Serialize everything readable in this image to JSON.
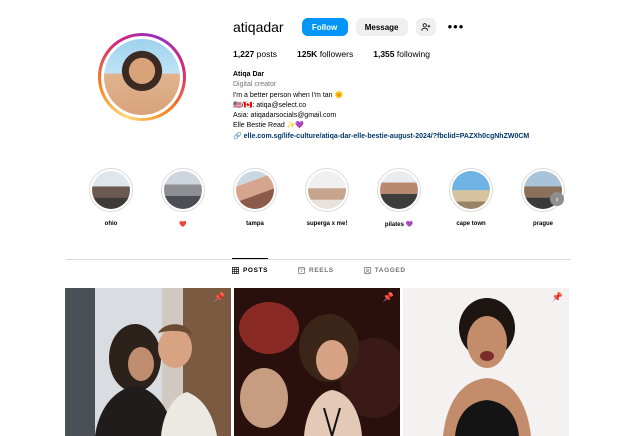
{
  "profile": {
    "username": "atiqadar",
    "follow_label": "Follow",
    "message_label": "Message",
    "more_label": "•••",
    "stats": {
      "posts_count": "1,227",
      "posts_label": "posts",
      "followers_count": "125K",
      "followers_label": "followers",
      "following_count": "1,355",
      "following_label": "following"
    },
    "bio": {
      "name": "Atiqa Dar",
      "category": "Digital creator",
      "line1": "I'm a better person when I'm tan 🌞",
      "line2": "🇺🇸/🇨🇦: atiqa@select.co",
      "line3": "Asia: atiqadarsocials@gmail.com",
      "line4": "Elle Bestie Read ✨💜",
      "link": "🔗 elle.com.sg/life-culture/atiqa-dar-elle-bestie-august-2024/?fbclid=PAZXh0cgNhZW0CM"
    }
  },
  "highlights": [
    {
      "label": "ohio"
    },
    {
      "label": "❤️"
    },
    {
      "label": "tampa"
    },
    {
      "label": "superga x me!"
    },
    {
      "label": "pilates 💜"
    },
    {
      "label": "cape town"
    },
    {
      "label": "prague"
    }
  ],
  "tabs": {
    "posts": "POSTS",
    "reels": "REELS",
    "tagged": "TAGGED"
  },
  "colors": {
    "accent": "#0095f6",
    "link": "#00376b"
  }
}
